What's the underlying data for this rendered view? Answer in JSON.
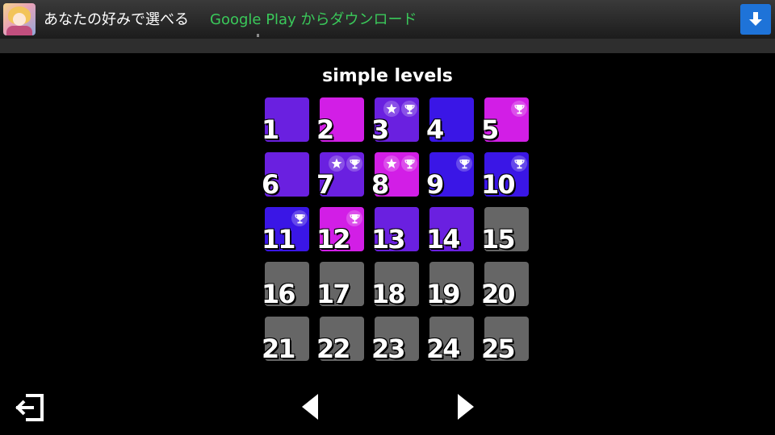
{
  "ad": {
    "text": "あなたの好みで選べる",
    "cta": "Google Play からダウンロード",
    "download_icon": "download-arrow-icon"
  },
  "title": "simple levels",
  "colors": {
    "blue": "#3a16e6",
    "violet": "#6a20e0",
    "magenta": "#d21ee6",
    "locked": "#666666"
  },
  "levels": [
    {
      "num": "1",
      "color": "violet",
      "star": false,
      "trophy": false
    },
    {
      "num": "2",
      "color": "magenta",
      "star": false,
      "trophy": false
    },
    {
      "num": "3",
      "color": "violet",
      "star": true,
      "trophy": true
    },
    {
      "num": "4",
      "color": "blue",
      "star": false,
      "trophy": false
    },
    {
      "num": "5",
      "color": "magenta",
      "star": false,
      "trophy": true
    },
    {
      "num": "6",
      "color": "violet",
      "star": false,
      "trophy": false
    },
    {
      "num": "7",
      "color": "violet",
      "star": true,
      "trophy": true
    },
    {
      "num": "8",
      "color": "magenta",
      "star": true,
      "trophy": true
    },
    {
      "num": "9",
      "color": "blue",
      "star": false,
      "trophy": true
    },
    {
      "num": "10",
      "color": "blue",
      "star": false,
      "trophy": true
    },
    {
      "num": "11",
      "color": "blue",
      "star": false,
      "trophy": true
    },
    {
      "num": "12",
      "color": "magenta",
      "star": false,
      "trophy": true
    },
    {
      "num": "13",
      "color": "violet",
      "star": false,
      "trophy": false
    },
    {
      "num": "14",
      "color": "violet",
      "star": false,
      "trophy": false
    },
    {
      "num": "15",
      "color": "locked",
      "star": false,
      "trophy": false
    },
    {
      "num": "16",
      "color": "locked",
      "star": false,
      "trophy": false
    },
    {
      "num": "17",
      "color": "locked",
      "star": false,
      "trophy": false
    },
    {
      "num": "18",
      "color": "locked",
      "star": false,
      "trophy": false
    },
    {
      "num": "19",
      "color": "locked",
      "star": false,
      "trophy": false
    },
    {
      "num": "20",
      "color": "locked",
      "star": false,
      "trophy": false
    },
    {
      "num": "21",
      "color": "locked",
      "star": false,
      "trophy": false
    },
    {
      "num": "22",
      "color": "locked",
      "star": false,
      "trophy": false
    },
    {
      "num": "23",
      "color": "locked",
      "star": false,
      "trophy": false
    },
    {
      "num": "24",
      "color": "locked",
      "star": false,
      "trophy": false
    },
    {
      "num": "25",
      "color": "locked",
      "star": false,
      "trophy": false
    }
  ],
  "controls": {
    "exit_icon": "exit-icon",
    "prev_icon": "previous-page-icon",
    "next_icon": "next-page-icon"
  }
}
